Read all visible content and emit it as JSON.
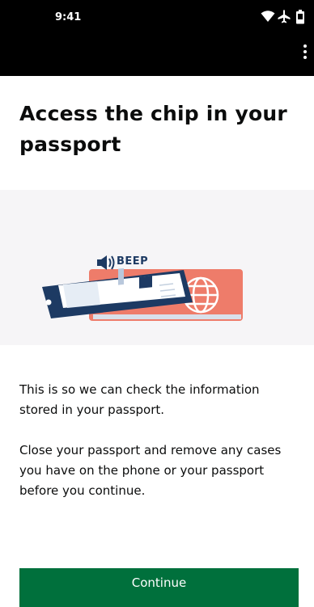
{
  "status_bar": {
    "time": "9:41",
    "icons": [
      "wifi-icon",
      "airplane-icon",
      "battery-icon"
    ],
    "background": "#000000"
  },
  "toolbar": {
    "menu_icon": "more-vertical-icon"
  },
  "page": {
    "title": "Access the chip in your passport",
    "illustration_label": "BEEP",
    "paragraph_1": "This is so we can check the information stored in your passport.",
    "paragraph_2": "Close your passport and remove any cases you have on the phone or your passport before you continue."
  },
  "actions": {
    "continue_label": "Continue"
  },
  "colors": {
    "primary_button": "#00703c",
    "phone": "#1d3a63",
    "passport": "#ee7c6a",
    "text": "#0b0c0c"
  }
}
